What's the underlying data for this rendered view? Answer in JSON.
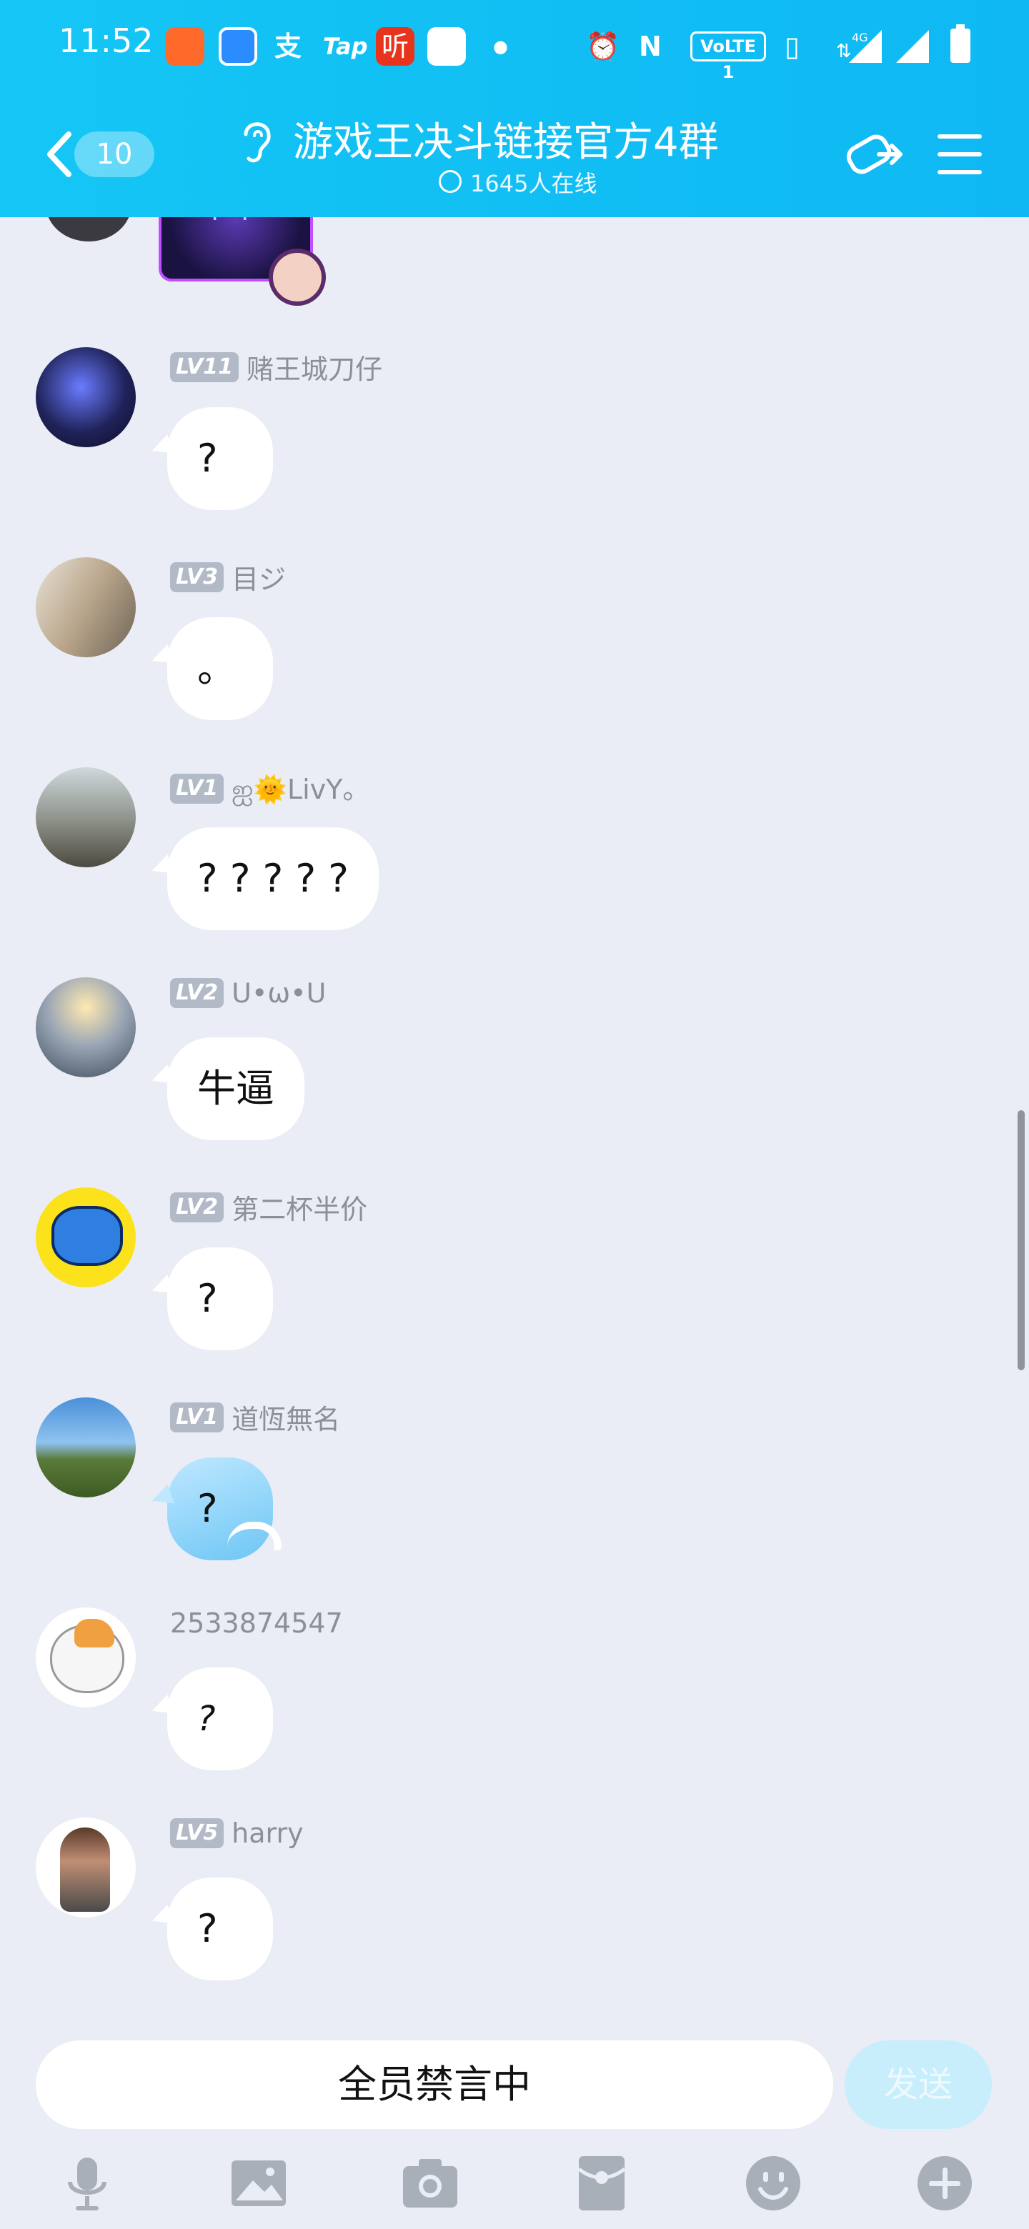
{
  "status_bar": {
    "time": "11:52",
    "apps": [
      "shop-app",
      "star-app",
      "alipay-app",
      "taptap-app",
      "listen-app",
      "net-app"
    ],
    "tap_label": "Tap",
    "listen_label": "听",
    "volte_label": "VoLTE 1",
    "network_label": "4G"
  },
  "header": {
    "back_count": "10",
    "title": "游戏王决斗链接官方4群",
    "online": "1645人在线"
  },
  "messages": [
    {
      "level": "LV11",
      "name": "赌王城刀仔",
      "text": "?"
    },
    {
      "level": "LV3",
      "name": "目ジ",
      "text": "。"
    },
    {
      "level": "LV1",
      "name": "ஐ🌞LivY。",
      "text": "? ? ? ? ?"
    },
    {
      "level": "LV2",
      "name": "ᑌ•ω•ᑌ",
      "text": "牛逼"
    },
    {
      "level": "LV2",
      "name": "第二杯半价",
      "text": "?"
    },
    {
      "level": "LV1",
      "name": "道恆無名",
      "text": "?"
    },
    {
      "level": "",
      "name": "2533874547",
      "text": "?"
    },
    {
      "level": "LV5",
      "name": "harry",
      "text": "?"
    }
  ],
  "input": {
    "muted_text": "全员禁言中",
    "send_label": "发送"
  },
  "colors": {
    "header": "#14c6f5",
    "background": "#eaedf5",
    "level_badge": "#b3bac7",
    "send_disabled": "#c8eefb"
  },
  "toolbar_icons": [
    "mic-icon",
    "image-icon",
    "camera-icon",
    "red-packet-icon",
    "emoji-icon",
    "plus-icon"
  ]
}
